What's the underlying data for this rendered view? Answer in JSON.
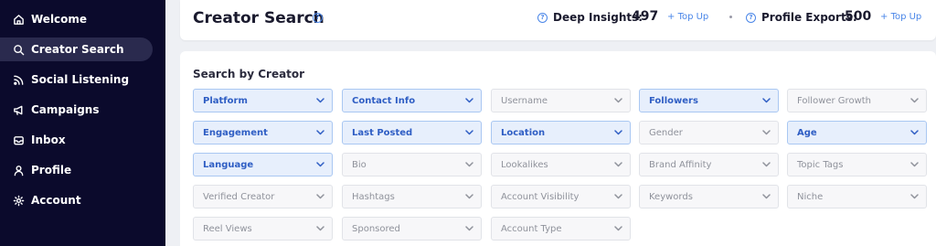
{
  "sidebar": {
    "items": [
      {
        "label": "Welcome",
        "icon": "home-icon"
      },
      {
        "label": "Creator Search",
        "icon": "search-icon"
      },
      {
        "label": "Social Listening",
        "icon": "rss-icon"
      },
      {
        "label": "Campaigns",
        "icon": "megaphone-icon"
      },
      {
        "label": "Inbox",
        "icon": "inbox-icon"
      },
      {
        "label": "Profile",
        "icon": "user-icon"
      },
      {
        "label": "Account",
        "icon": "gear-icon"
      }
    ],
    "active_item": "Creator Search"
  },
  "header": {
    "title": "Creator Search",
    "deep_insights_label": "Deep Insights:",
    "deep_insights_value": "497",
    "profile_exports_label": "Profile Exports:",
    "profile_exports_value": "500",
    "topup_label": "Top Up"
  },
  "filters": {
    "title": "Search by Creator",
    "chips": [
      {
        "label": "Platform",
        "active": true
      },
      {
        "label": "Contact Info",
        "active": true
      },
      {
        "label": "Username",
        "active": false
      },
      {
        "label": "Followers",
        "active": true
      },
      {
        "label": "Follower Growth",
        "active": false
      },
      {
        "label": "Engagement",
        "active": true
      },
      {
        "label": "Last Posted",
        "active": true
      },
      {
        "label": "Location",
        "active": true
      },
      {
        "label": "Gender",
        "active": false
      },
      {
        "label": "Age",
        "active": true
      },
      {
        "label": "Language",
        "active": true
      },
      {
        "label": "Bio",
        "active": false
      },
      {
        "label": "Lookalikes",
        "active": false
      },
      {
        "label": "Brand Affinity",
        "active": false
      },
      {
        "label": "Topic Tags",
        "active": false
      },
      {
        "label": "Verified Creator",
        "active": false
      },
      {
        "label": "Hashtags",
        "active": false
      },
      {
        "label": "Account Visibility",
        "active": false
      },
      {
        "label": "Keywords",
        "active": false
      },
      {
        "label": "Niche",
        "active": false
      },
      {
        "label": "Reel Views",
        "active": false
      },
      {
        "label": "Sponsored",
        "active": false
      },
      {
        "label": "Account Type",
        "active": false
      }
    ]
  },
  "colors": {
    "sidebar_bg": "#0b0a2c",
    "accent": "#4a86e8",
    "chip_active_bg": "#e7effc",
    "chip_active_text": "#2f5ec4"
  }
}
